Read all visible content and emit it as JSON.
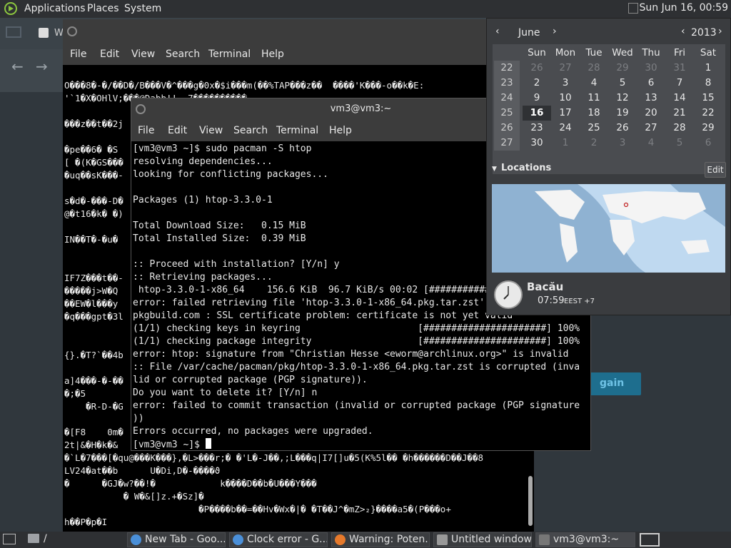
{
  "top_panel": {
    "menus": [
      "Applications",
      "Places",
      "System"
    ],
    "clock": "Sun Jun 16, 00:59"
  },
  "browser": {
    "tab_text": "W",
    "try_again": "gain"
  },
  "terminal_back": {
    "menus": [
      "File",
      "Edit",
      "View",
      "Search",
      "Terminal",
      "Help"
    ],
    "content": "O���8�-�/��D�/B���V�^���g�0x�$i���m(��%TAP���z��  ����'K���-o��k�E:\n'`1�X�OHlV;���@Dabb!!  7����������\n\n���z��t��2j\n\n�pe��6� �S\n[ �(K�GS���\n�uq��sK���-\n\ns�d�-���-D�\n@�t16�k� �)\n\nIN��T�-�u�\n\n\nIF7Z���t��-\n�����j>W�Q\n��EW�l���y\n�q���gpt�3l\n\n\n{}.�T?`��4b\n\na]4���-�-��\n�;�5\n    �R-D-�G\n\n�[F8    0m�\n2t|&�H�k�&\n�`L�7���[�qu@���K���},�L>���r;� �'L�-J��,;L���q|I7[]u�5(K%5l�� �h������D��J��8\nLV24�at��b      U�Di,D�-����ϑ\n�      �GJ�w?��!�            k����D��b�U���Y���\n           � W�&[]z.+�Sz]�\n                         �P����b��=��Hv�Wx�|� �T��J^�mZ>₂}����a5�(P���o+\nh��P�p�I"
  },
  "terminal_front": {
    "title": "vm3@vm3:~",
    "menus": [
      "File",
      "Edit",
      "View",
      "Search",
      "Terminal",
      "Help"
    ],
    "content": "[vm3@vm3 ~]$ sudo pacman -S htop\nresolving dependencies...\nlooking for conflicting packages...\n\nPackages (1) htop-3.3.0-1\n\nTotal Download Size:   0.15 MiB\nTotal Installed Size:  0.39 MiB\n\n:: Proceed with installation? [Y/n] y\n:: Retrieving packages...\n htop-3.3.0-1-x86_64    156.6 KiB  96.7 KiB/s 00:02 [######################] 100%\nerror: failed retrieving file 'htop-3.3.0-1-x86_64.pkg.tar.zst' from\npkgbuild.com : SSL certificate problem: certificate is not yet valid\n(1/1) checking keys in keyring                     [######################] 100%\n(1/1) checking package integrity                   [######################] 100%\nerror: htop: signature from \"Christian Hesse <eworm@archlinux.org>\" is invalid\n:: File /var/cache/pacman/pkg/htop-3.3.0-1-x86_64.pkg.tar.zst is corrupted (inva\nlid or corrupted package (PGP signature)).\nDo you want to delete it? [Y/n] n\nerror: failed to commit transaction (invalid or corrupted package (PGP signature\n))\nErrors occurred, no packages were upgraded.\n[vm3@vm3 ~]$ "
  },
  "calendar": {
    "month": "June",
    "year": "2013",
    "weekdays": [
      "Sun",
      "Mon",
      "Tue",
      "Wed",
      "Thu",
      "Fri",
      "Sat"
    ],
    "weeks": [
      {
        "num": "22",
        "days": [
          "26",
          "27",
          "28",
          "29",
          "30",
          "31",
          "1"
        ],
        "dim": [
          true,
          true,
          true,
          true,
          true,
          true,
          false
        ]
      },
      {
        "num": "23",
        "days": [
          "2",
          "3",
          "4",
          "5",
          "6",
          "7",
          "8"
        ],
        "dim": [
          false,
          false,
          false,
          false,
          false,
          false,
          false
        ]
      },
      {
        "num": "24",
        "days": [
          "9",
          "10",
          "11",
          "12",
          "13",
          "14",
          "15"
        ],
        "dim": [
          false,
          false,
          false,
          false,
          false,
          false,
          false
        ]
      },
      {
        "num": "25",
        "days": [
          "16",
          "17",
          "18",
          "19",
          "20",
          "21",
          "22"
        ],
        "dim": [
          false,
          false,
          false,
          false,
          false,
          false,
          false
        ]
      },
      {
        "num": "26",
        "days": [
          "23",
          "24",
          "25",
          "26",
          "27",
          "28",
          "29"
        ],
        "dim": [
          false,
          false,
          false,
          false,
          false,
          false,
          false
        ]
      },
      {
        "num": "27",
        "days": [
          "30",
          "1",
          "2",
          "3",
          "4",
          "5",
          "6"
        ],
        "dim": [
          false,
          true,
          true,
          true,
          true,
          true,
          true
        ]
      }
    ],
    "today": "16",
    "locations_label": "Locations",
    "edit_label": "Edit",
    "city": "Bacău",
    "city_time": "07:59",
    "city_tz": "EEST +7"
  },
  "taskbar": {
    "folder_label": "/",
    "tasks": [
      {
        "label": "New Tab - Goo...",
        "icon": "chrome-icon"
      },
      {
        "label": "Clock error - G...",
        "icon": "chrome-icon"
      },
      {
        "label": "Warning: Poten...",
        "icon": "firefox-icon"
      },
      {
        "label": "Untitled window",
        "icon": "window-icon"
      },
      {
        "label": "vm3@vm3:~",
        "icon": "terminal-icon"
      }
    ]
  },
  "colors": {
    "panel": "#2e3033",
    "terminal_bg": "#000000",
    "accent": "#8cc63f"
  }
}
